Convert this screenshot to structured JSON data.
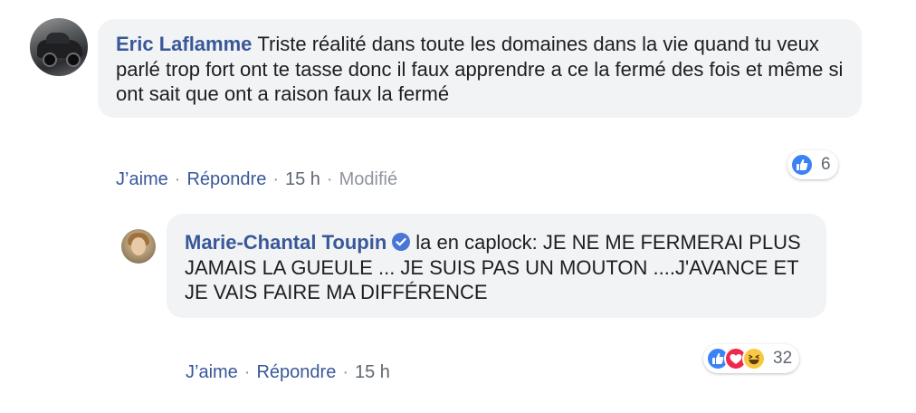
{
  "comments": [
    {
      "author": "Eric Laflamme",
      "text": "Triste réalité dans toute les domaines dans la vie quand tu veux parlé trop fort ont te tasse donc il faux apprendre a ce la fermé des fois et même si ont sait que ont a raison faux la fermé",
      "reaction_count": "6",
      "reactions": [
        "like-icon"
      ],
      "like_label": "J’aime",
      "reply_label": "Répondre",
      "time": "15 h",
      "edited_label": "Modifié"
    },
    {
      "author": "Marie-Chantal Toupin",
      "verified": true,
      "text": "la en caplock: JE NE ME FERMERAI PLUS JAMAIS LA GUEULE ... JE SUIS PAS UN MOUTON ....J'AVANCE ET JE VAIS FAIRE MA DIFFÉRENCE",
      "reaction_count": "32",
      "reactions": [
        "like-icon",
        "love-icon",
        "haha-icon"
      ],
      "like_label": "J’aime",
      "reply_label": "Répondre",
      "time": "15 h"
    }
  ],
  "colors": {
    "author": "#385898",
    "bubble": "#f2f3f5",
    "like": "#3b82f6",
    "love": "#f0284a",
    "haha": "#f7c843"
  }
}
